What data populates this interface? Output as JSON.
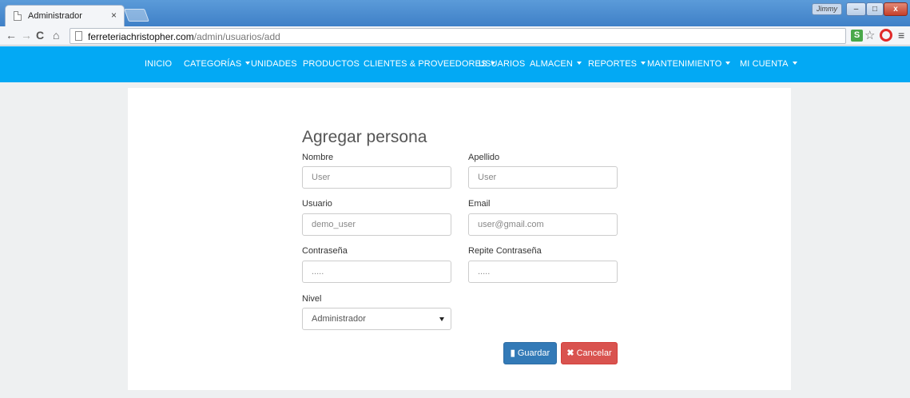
{
  "browser": {
    "tab_title": "Administrador",
    "tab_close": "×",
    "profile_name": "Jimmy",
    "url_host": "ferreteriachristopher.com",
    "url_path": "/admin/usuarios/add",
    "ext_label": "S",
    "window_buttons": {
      "minimize": "–",
      "maximize": "□",
      "close": "x"
    }
  },
  "navbar": {
    "items": [
      {
        "label": "INICIO"
      },
      {
        "label": "CATEGORÍAS"
      },
      {
        "label": "UNIDADES"
      },
      {
        "label": "PRODUCTOS"
      },
      {
        "label": "CLIENTES & PROVEEDORES"
      },
      {
        "label": "USUARIOS"
      },
      {
        "label": "ALMACEN"
      },
      {
        "label": "REPORTES"
      },
      {
        "label": "MANTENIMIENTO"
      },
      {
        "label": "MI CUENTA"
      }
    ]
  },
  "form": {
    "title": "Agregar persona",
    "fields": {
      "nombre": {
        "label": "Nombre",
        "placeholder": "User"
      },
      "apellido": {
        "label": "Apellido",
        "placeholder": "User"
      },
      "usuario": {
        "label": "Usuario",
        "placeholder": "demo_user"
      },
      "email": {
        "label": "Email",
        "placeholder": "user@gmail.com"
      },
      "contrasena": {
        "label": "Contraseña",
        "placeholder": "....."
      },
      "repite_contrasena": {
        "label": "Repite Contraseña",
        "placeholder": "....."
      },
      "nivel": {
        "label": "Nivel",
        "selected": "Administrador"
      }
    },
    "buttons": {
      "save": "Guardar",
      "cancel": "Cancelar"
    }
  }
}
